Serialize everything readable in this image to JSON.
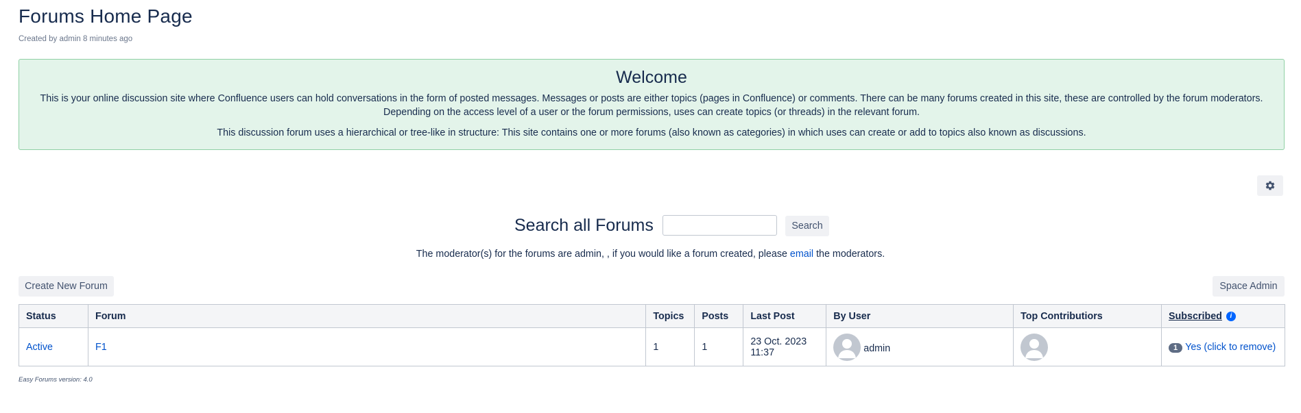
{
  "page": {
    "title": "Forums Home Page",
    "byline": "Created by admin 8 minutes ago"
  },
  "welcome": {
    "heading": "Welcome",
    "paragraph1": "This is your online discussion site where Confluence users can hold conversations in the form of posted messages. Messages or posts are either topics (pages in Confluence) or comments. There can be many forums created in this site, these are controlled by the forum moderators. Depending on the access level of a user or the forum permissions, uses can create topics (or threads) in the relevant forum.",
    "paragraph2": "This discussion forum uses a hierarchical or tree-like in structure: This site contains one or more forums (also known as categories) in which uses can create or add to topics also known as discussions."
  },
  "toolbar": {
    "settings_icon": "gear-icon"
  },
  "search": {
    "label": "Search all Forums",
    "value": "",
    "button_label": "Search"
  },
  "moderators": {
    "prefix": "The moderator(s) for the forums are admin, , if you would like a forum created, please ",
    "link_text": "email",
    "suffix": " the moderators."
  },
  "actions": {
    "create_label": "Create New Forum",
    "space_admin_label": "Space Admin"
  },
  "table": {
    "headers": {
      "status": "Status",
      "forum": "Forum",
      "topics": "Topics",
      "posts": "Posts",
      "last_post": "Last Post",
      "by_user": "By User",
      "top_contributors": "Top Contributiors",
      "subscribed": "Subscribed",
      "subscribed_info_icon": "info-icon"
    },
    "rows": [
      {
        "status": "Active",
        "forum": "F1",
        "topics": "1",
        "posts": "1",
        "last_post_date": "23 Oct. 2023",
        "last_post_time": "11:37",
        "by_user": "admin",
        "subscriber_count": "1",
        "subscribed_link": "Yes (click to remove)"
      }
    ]
  },
  "footer": {
    "version": "Easy Forums version: 4.0"
  },
  "colors": {
    "welcome_bg": "#e3f4ea",
    "welcome_border": "#8fd0a4",
    "link": "#0052cc",
    "button_bg": "#f0f1f4",
    "avatar": "#c1c7d0"
  }
}
